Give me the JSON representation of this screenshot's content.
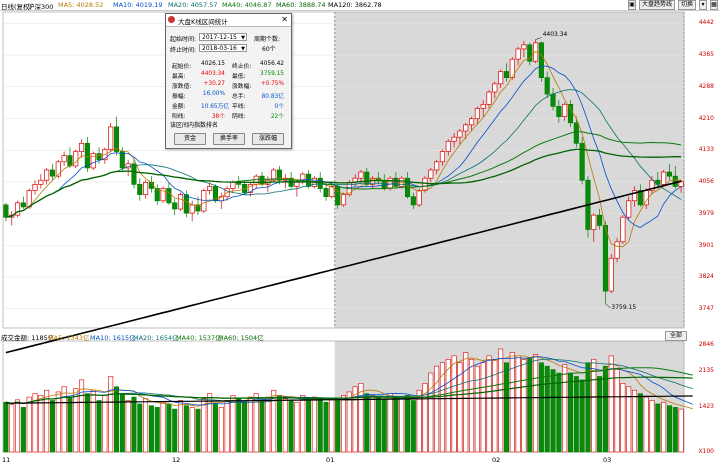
{
  "header": {
    "title": "日线(复权)",
    "index": "沪深300",
    "ma5": "MA5: 4028.52",
    "ma10": "MA10: 4019.19",
    "ma20": "MA20: 4057.57",
    "ma40": "MA40: 4046.87",
    "ma60": "MA60: 3888.74",
    "ma120": "MA120: 3862.78",
    "buttons": [
      "大盘趋势线",
      "切换"
    ],
    "colors": {
      "ma5": "#b87a00",
      "ma10": "#0050c8",
      "ma20": "#0b6f6f",
      "ma40": "#0a7a0a",
      "ma60": "#006400",
      "ma120": "#000000"
    }
  },
  "price_axis": [
    "4442",
    "4365",
    "4288",
    "4210",
    "4133",
    "4056",
    "3979",
    "3901",
    "3824",
    "3747"
  ],
  "annotations": {
    "high": "4403.34",
    "low": "3759.15"
  },
  "volume_header": {
    "label": "成交金额: 1185亿",
    "ma5": "MA5: 1343亿",
    "ma10": "MA10: 1615亿",
    "ma20": "MA20: 1654亿",
    "ma40": "MA40: 1537亿",
    "ma60": "MA60: 1504亿"
  },
  "volume_axis": [
    "2846",
    "2135",
    "1423",
    "X100"
  ],
  "x_axis": [
    "11",
    "12",
    "01",
    "02",
    "03"
  ],
  "corner_button": "全部",
  "dialog": {
    "title": "大盘K线区间统计",
    "start_label": "起始时间:",
    "start_value": "2017-12-15",
    "end_label": "终止时间:",
    "end_value": "2018-03-16",
    "period_label": "周期个数:",
    "period_value": "60个",
    "stats": [
      {
        "k1": "起始价:",
        "v1": "4026.15",
        "c1": "",
        "k2": "终止价:",
        "v2": "4056.42",
        "c2": ""
      },
      {
        "k1": "最高:",
        "v1": "4403.34",
        "c1": "red",
        "k2": "最低:",
        "v2": "3759.15",
        "c2": "green"
      },
      {
        "k1": "涨跌值:",
        "v1": "+30.27",
        "c1": "red",
        "k2": "涨跌幅:",
        "v2": "+0.75%",
        "c2": "red"
      },
      {
        "k1": "振幅:",
        "v1": "16.00%",
        "c1": "blue",
        "k2": "总手:",
        "v2": "80.83亿",
        "c2": "blue"
      },
      {
        "k1": "金额:",
        "v1": "10.65万亿",
        "c1": "blue",
        "k2": "平线:",
        "v2": "0个",
        "c2": "blue"
      },
      {
        "k1": "阳线:",
        "v1": "38个",
        "c1": "red",
        "k2": "阴线:",
        "v2": "22个",
        "c2": "green"
      }
    ],
    "rank_label": "该区间内指数排名",
    "buttons": [
      "资金",
      "换手率",
      "涨跌幅"
    ]
  },
  "chart_data": {
    "type": "candlestick",
    "count": 117,
    "selection_start_index": 57,
    "candles": [
      [
        4000,
        4005,
        3960,
        3970
      ],
      [
        3970,
        3985,
        3950,
        3975
      ],
      [
        3975,
        4010,
        3970,
        4005
      ],
      [
        4005,
        4020,
        3990,
        3995
      ],
      [
        3995,
        4040,
        3990,
        4035
      ],
      [
        4035,
        4060,
        4025,
        4050
      ],
      [
        4050,
        4075,
        4040,
        4060
      ],
      [
        4060,
        4090,
        4050,
        4085
      ],
      [
        4085,
        4100,
        4060,
        4070
      ],
      [
        4070,
        4110,
        4065,
        4105
      ],
      [
        4105,
        4130,
        4095,
        4120
      ],
      [
        4120,
        4140,
        4090,
        4095
      ],
      [
        4095,
        4135,
        4090,
        4130
      ],
      [
        4130,
        4160,
        4115,
        4150
      ],
      [
        4150,
        4165,
        4080,
        4090
      ],
      [
        4090,
        4130,
        4085,
        4125
      ],
      [
        4125,
        4140,
        4100,
        4110
      ],
      [
        4110,
        4140,
        4100,
        4135
      ],
      [
        4135,
        4200,
        4130,
        4190
      ],
      [
        4190,
        4215,
        4120,
        4130
      ],
      [
        4130,
        4140,
        4080,
        4090
      ],
      [
        4090,
        4110,
        4070,
        4100
      ],
      [
        4100,
        4115,
        4040,
        4050
      ],
      [
        4050,
        4065,
        4010,
        4025
      ],
      [
        4025,
        4060,
        4015,
        4055
      ],
      [
        4055,
        4070,
        4030,
        4040
      ],
      [
        4040,
        4050,
        4000,
        4010
      ],
      [
        4010,
        4045,
        4005,
        4040
      ],
      [
        4040,
        4055,
        4000,
        4005
      ],
      [
        4005,
        4015,
        3975,
        3990
      ],
      [
        3990,
        4030,
        3985,
        4025
      ],
      [
        4025,
        4035,
        3970,
        3980
      ],
      [
        3980,
        4010,
        3960,
        4000
      ],
      [
        4000,
        4020,
        3975,
        3985
      ],
      [
        3985,
        4040,
        3980,
        4035
      ],
      [
        4035,
        4055,
        4025,
        4045
      ],
      [
        4045,
        4050,
        4005,
        4010
      ],
      [
        4010,
        4030,
        3990,
        4020
      ],
      [
        4020,
        4045,
        4010,
        4040
      ],
      [
        4040,
        4060,
        4030,
        4055
      ],
      [
        4055,
        4070,
        4040,
        4050
      ],
      [
        4050,
        4060,
        4025,
        4030
      ],
      [
        4030,
        4055,
        4020,
        4050
      ],
      [
        4050,
        4075,
        4040,
        4070
      ],
      [
        4070,
        4080,
        4045,
        4050
      ],
      [
        4050,
        4070,
        4030,
        4060
      ],
      [
        4060,
        4090,
        4055,
        4085
      ],
      [
        4085,
        4095,
        4050,
        4060
      ],
      [
        4060,
        4075,
        4040,
        4065
      ],
      [
        4065,
        4080,
        4040,
        4045
      ],
      [
        4045,
        4060,
        4020,
        4055
      ],
      [
        4055,
        4080,
        4050,
        4075
      ],
      [
        4075,
        4085,
        4040,
        4045
      ],
      [
        4045,
        4070,
        4040,
        4065
      ],
      [
        4065,
        4080,
        4030,
        4040
      ],
      [
        4040,
        4055,
        4010,
        4020
      ],
      [
        4020,
        4050,
        4015,
        4045
      ],
      [
        4045,
        4050,
        3990,
        4000
      ],
      [
        4000,
        4030,
        3995,
        4025
      ],
      [
        4025,
        4060,
        4020,
        4055
      ],
      [
        4055,
        4075,
        4045,
        4065
      ],
      [
        4065,
        4085,
        4050,
        4080
      ],
      [
        4080,
        4090,
        4045,
        4050
      ],
      [
        4050,
        4070,
        4040,
        4065
      ],
      [
        4065,
        4080,
        4050,
        4060
      ],
      [
        4060,
        4075,
        4035,
        4040
      ],
      [
        4040,
        4070,
        4035,
        4065
      ],
      [
        4065,
        4080,
        4040,
        4045
      ],
      [
        4045,
        4070,
        4040,
        4065
      ],
      [
        4065,
        4080,
        4015,
        4020
      ],
      [
        4020,
        4030,
        3990,
        4000
      ],
      [
        4000,
        4040,
        3995,
        4035
      ],
      [
        4035,
        4070,
        4030,
        4065
      ],
      [
        4065,
        4090,
        4055,
        4085
      ],
      [
        4085,
        4110,
        4075,
        4105
      ],
      [
        4105,
        4135,
        4095,
        4130
      ],
      [
        4130,
        4160,
        4120,
        4155
      ],
      [
        4155,
        4175,
        4140,
        4165
      ],
      [
        4165,
        4185,
        4145,
        4180
      ],
      [
        4180,
        4200,
        4160,
        4195
      ],
      [
        4195,
        4215,
        4180,
        4210
      ],
      [
        4210,
        4240,
        4195,
        4235
      ],
      [
        4235,
        4255,
        4215,
        4245
      ],
      [
        4245,
        4280,
        4235,
        4275
      ],
      [
        4275,
        4300,
        4260,
        4295
      ],
      [
        4295,
        4330,
        4285,
        4325
      ],
      [
        4325,
        4345,
        4300,
        4310
      ],
      [
        4310,
        4360,
        4305,
        4355
      ],
      [
        4355,
        4385,
        4340,
        4380
      ],
      [
        4380,
        4400,
        4360,
        4390
      ],
      [
        4390,
        4395,
        4340,
        4350
      ],
      [
        4350,
        4403,
        4345,
        4395
      ],
      [
        4395,
        4398,
        4300,
        4310
      ],
      [
        4310,
        4325,
        4260,
        4270
      ],
      [
        4270,
        4285,
        4230,
        4240
      ],
      [
        4240,
        4255,
        4200,
        4215
      ],
      [
        4215,
        4250,
        4205,
        4245
      ],
      [
        4245,
        4255,
        4190,
        4200
      ],
      [
        4200,
        4215,
        4140,
        4150
      ],
      [
        4150,
        4165,
        4050,
        4060
      ],
      [
        4060,
        4070,
        3920,
        3940
      ],
      [
        3940,
        3980,
        3910,
        3975
      ],
      [
        3975,
        3990,
        3940,
        3950
      ],
      [
        3950,
        3960,
        3759,
        3790
      ],
      [
        3790,
        3880,
        3785,
        3870
      ],
      [
        3870,
        3920,
        3860,
        3910
      ],
      [
        3910,
        3975,
        3905,
        3970
      ],
      [
        3970,
        4020,
        3965,
        4010
      ],
      [
        4010,
        4045,
        3995,
        4035
      ],
      [
        4035,
        4050,
        3995,
        4000
      ],
      [
        4000,
        4040,
        3990,
        4035
      ],
      [
        4035,
        4070,
        4025,
        4060
      ],
      [
        4060,
        4080,
        4040,
        4050
      ],
      [
        4050,
        4085,
        4045,
        4080
      ],
      [
        4080,
        4100,
        4060,
        4070
      ],
      [
        4070,
        4095,
        4040,
        4045
      ],
      [
        4045,
        4060,
        4030,
        4056
      ]
    ],
    "volumes": [
      1450,
      1380,
      1520,
      1300,
      1600,
      1700,
      1650,
      1800,
      1500,
      1750,
      1900,
      1600,
      1850,
      2100,
      1700,
      1800,
      1500,
      1650,
      2200,
      1900,
      1700,
      1500,
      1600,
      1400,
      1550,
      1350,
      1300,
      1450,
      1400,
      1250,
      1500,
      1350,
      1300,
      1250,
      1550,
      1700,
      1400,
      1300,
      1500,
      1650,
      1550,
      1450,
      1600,
      1700,
      1500,
      1600,
      1800,
      1650,
      1550,
      1500,
      1450,
      1650,
      1500,
      1600,
      1550,
      1450,
      1550,
      1500,
      1650,
      1750,
      1900,
      2000,
      1700,
      1650,
      1600,
      1550,
      1700,
      1600,
      1550,
      1650,
      1500,
      1800,
      2000,
      2300,
      2500,
      2600,
      2700,
      2800,
      2600,
      2900,
      2700,
      2500,
      2600,
      2800,
      2700,
      3000,
      2600,
      2900,
      2800,
      2700,
      2750,
      2846,
      2600,
      2500,
      2400,
      2300,
      2550,
      2300,
      2200,
      2100,
      2600,
      2700,
      2200,
      2500,
      2800,
      2400,
      2000,
      1900,
      1800,
      1700,
      1600,
      1500,
      1400,
      1450,
      1350,
      1300,
      1250,
      1200,
      1185
    ]
  }
}
